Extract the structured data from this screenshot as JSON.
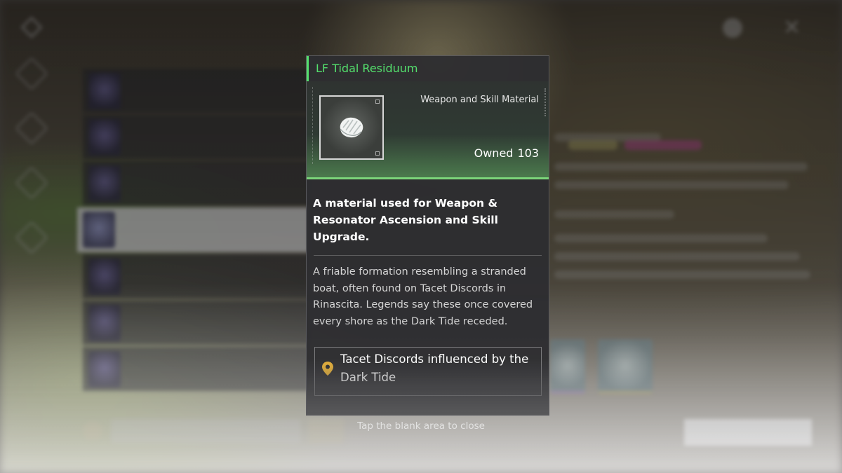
{
  "item": {
    "name": "LF Tidal Residuum",
    "type": "Weapon and Skill Material",
    "owned_label": "Owned",
    "owned_count": "103",
    "usage_description": "A material used for Weapon & Resonator Ascension and Skill Upgrade.",
    "lore_description": "A friable formation resembling a stranded boat, often found on Tacet Discords in Rinascita. Legends say these once covered every shore as the Dark Tide receded.",
    "source": "Tacet Discords influenced by the Dark Tide",
    "icon": "shell-residuum-icon"
  },
  "hint": {
    "close": "Tap the blank area to close"
  },
  "colors": {
    "accent_green": "#54e06d",
    "panel_bg": "#2e2e31",
    "source_pin": "#e8b23a"
  }
}
